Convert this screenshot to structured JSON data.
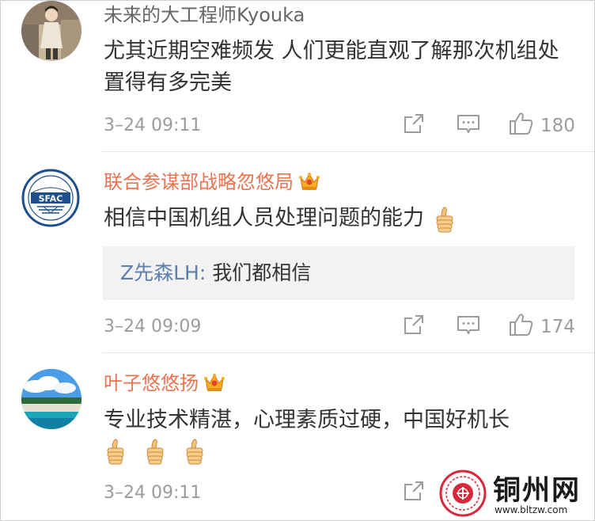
{
  "colors": {
    "vip_name": "#eb7350",
    "reply_name": "#5d7fae",
    "meta": "#9c9c9c",
    "reply_bg": "#f2f2f2"
  },
  "comments": [
    {
      "author": "未来的大工程师Kyouka",
      "avatar_icon": "person-photo-avatar",
      "text": "尤其近期空难频发 人们更能直观了解那次机组处置得有多完美",
      "time": "3–24 09:11",
      "likes": "180"
    },
    {
      "author": "联合参谋部战略忽悠局",
      "avatar_icon": "sfac-logo-avatar",
      "avatar_text": "SFAC",
      "badge_icon": "crown-icon",
      "text": "相信中国机组人员处理问题的能力",
      "emoji": "thumbs-up-icon",
      "reply": {
        "name": "Z先森LH:",
        "text": "我们都相信"
      },
      "time": "3–24 09:09",
      "likes": "174"
    },
    {
      "author": "叶子悠悠扬",
      "avatar_icon": "beach-photo-avatar",
      "badge_icon": "crown-icon",
      "text": "专业技术精湛，心理素质过硬，中国好机长",
      "emoji": "thumbs-up-icon",
      "emoji_count": 3,
      "time": "3–24 09:11"
    }
  ],
  "watermark": {
    "title": "铜州网",
    "url": "www.bltzw.com"
  }
}
